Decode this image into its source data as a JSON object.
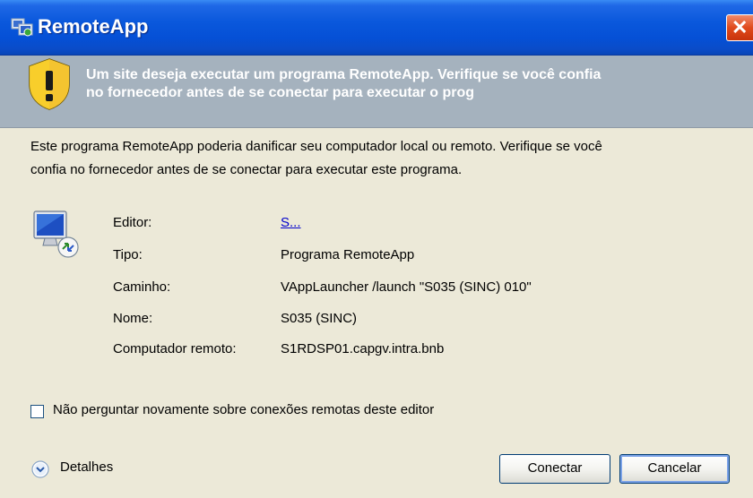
{
  "window": {
    "title": "RemoteApp",
    "close_glyph": "✕",
    "icon": "remoteapp-icon"
  },
  "warning": {
    "icon": "shield-warning-icon",
    "line1": "Um site deseja executar um programa RemoteApp. Verifique se você confia",
    "line2": "no fornecedor antes de se conectar para executar o prog"
  },
  "description": {
    "line1": "Este programa RemoteApp poderia danificar seu computador local ou remoto. Verifique se você",
    "line2": "confia no fornecedor antes de se conectar para executar este programa."
  },
  "details_table": [
    {
      "label": "Editor:",
      "value": "S..."
    },
    {
      "label": "Tipo:",
      "value": "Programa RemoteApp"
    },
    {
      "label": "Caminho:",
      "value": "VAppLauncher /launch \"S035 (SINC) 010\""
    },
    {
      "label": "Nome:",
      "value": "S035 (SINC)"
    },
    {
      "label": "Computador remoto:",
      "value": "S1RDSP01.capgv.intra.bnb"
    }
  ],
  "checkbox": {
    "label": "Não perguntar novamente sobre conexões remotas deste editor",
    "checked": false
  },
  "details_toggle": {
    "label": "Detalhes",
    "icon": "chevron-down-circle-icon"
  },
  "buttons": {
    "connect": "Conectar",
    "cancel": "Cancelar"
  },
  "colors": {
    "titlebar": "#0550d6",
    "warning_band": "#a5b2be",
    "background": "#ece9d8",
    "link": "#0000cc"
  }
}
